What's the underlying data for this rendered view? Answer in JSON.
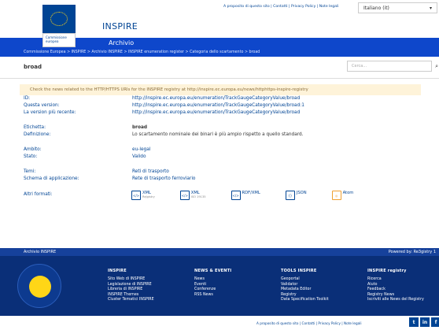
{
  "header": {
    "top_links": "A proposito di questo sito | Contatti | Privacy Policy | Note legali",
    "language": "Italiano (it)",
    "lang_arrow": "▾",
    "site_title": "INSPIRE",
    "eu_label": "Commissione europea",
    "section_title": "Archivio"
  },
  "breadcrumb": "Commissione Europea > INSPIRE > Archivio INSPIRE > INSPIRE enumeration register > Categoria dello scartamento > broad",
  "page": {
    "title": "broad",
    "search_placeholder": "Cerca..."
  },
  "notice": "Check the news related to the HTTP/HTTPS URIs for the INSPIRE registry at http://inspire.ec.europa.eu/news/httphttps-inspire-registry",
  "details": [
    {
      "label": "ID:",
      "value": "http://inspire.ec.europa.eu/enumeration/TrackGaugeCategoryValue/broad",
      "style": "link"
    },
    {
      "label": "Questa version:",
      "value": "http://inspire.ec.europa.eu/enumeration/TrackGaugeCategoryValue/broad:1",
      "style": "link"
    },
    {
      "label": "La version più recente:",
      "value": "http://inspire.ec.europa.eu/enumeration/TrackGaugeCategoryValue/broad",
      "style": "link"
    },
    {
      "label": "Etichetta:",
      "value": "broad",
      "style": "bold",
      "gap": true
    },
    {
      "label": "Definizione:",
      "value": "Lo scartamento nominale dei binari è più ampio rispetto a quello standard.",
      "style": "text"
    },
    {
      "label": "Ambito:",
      "value": "eu-legal",
      "style": "link",
      "gap": true
    },
    {
      "label": "Stato:",
      "value": "Valido",
      "style": "link"
    },
    {
      "label": "Temi:",
      "value": "Reti di trasporto",
      "style": "link",
      "gap": true
    },
    {
      "label": "Schema di applicazione:",
      "value": "Rete di trasporto ferroviario",
      "style": "link"
    }
  ],
  "formats": {
    "label": "Altri formati:",
    "items": [
      {
        "name": "XML",
        "sub": "ReJgistry",
        "icon": "xml-file-icon",
        "glyph": "</>"
      },
      {
        "name": "XML",
        "sub": "ISO 19135",
        "icon": "xml-file-icon",
        "glyph": "</>"
      },
      {
        "name": "RDF/XML",
        "sub": "",
        "icon": "rdf-file-icon",
        "glyph": "</>"
      },
      {
        "name": "JSON",
        "sub": "",
        "icon": "json-file-icon",
        "glyph": "{}"
      },
      {
        "name": "Atom",
        "sub": "",
        "icon": "atom-feed-icon",
        "glyph": "◎"
      }
    ]
  },
  "footer_bar": {
    "left": "Archivio INSPIRE",
    "right": "Powered by: Re3gistry 1"
  },
  "footer_columns": [
    {
      "title": "INSPIRE",
      "items": [
        "Sito Web di INSPIRE",
        "Legislazione di INSPIRE",
        "Libreria di INSPIRE",
        "INSPIRE Themes",
        "Cluster Tematici INSPIRE"
      ]
    },
    {
      "title": "NEWS & EVENTI",
      "items": [
        "News",
        "Eventi",
        "Conferenze",
        "RSS News"
      ]
    },
    {
      "title": "TOOLS INSPIRE",
      "items": [
        "Geoportal",
        "Validator",
        "Metadata Editor",
        "Registry",
        "Data Specification Toolkit"
      ]
    },
    {
      "title": "INSPIRE registry",
      "items": [
        "Ricerca",
        "Aiuto",
        "Feedback",
        "Registry News",
        "Iscriviti alle News del Registry"
      ]
    }
  ],
  "bottom_links": "A proposito di questo sito | Contatti | Privacy Policy | Note legali",
  "colors": {
    "eu_blue": "#004494",
    "band_blue": "#0e47cb",
    "footer_blue": "#0a2f78",
    "notice_bg": "#fef3d9"
  }
}
